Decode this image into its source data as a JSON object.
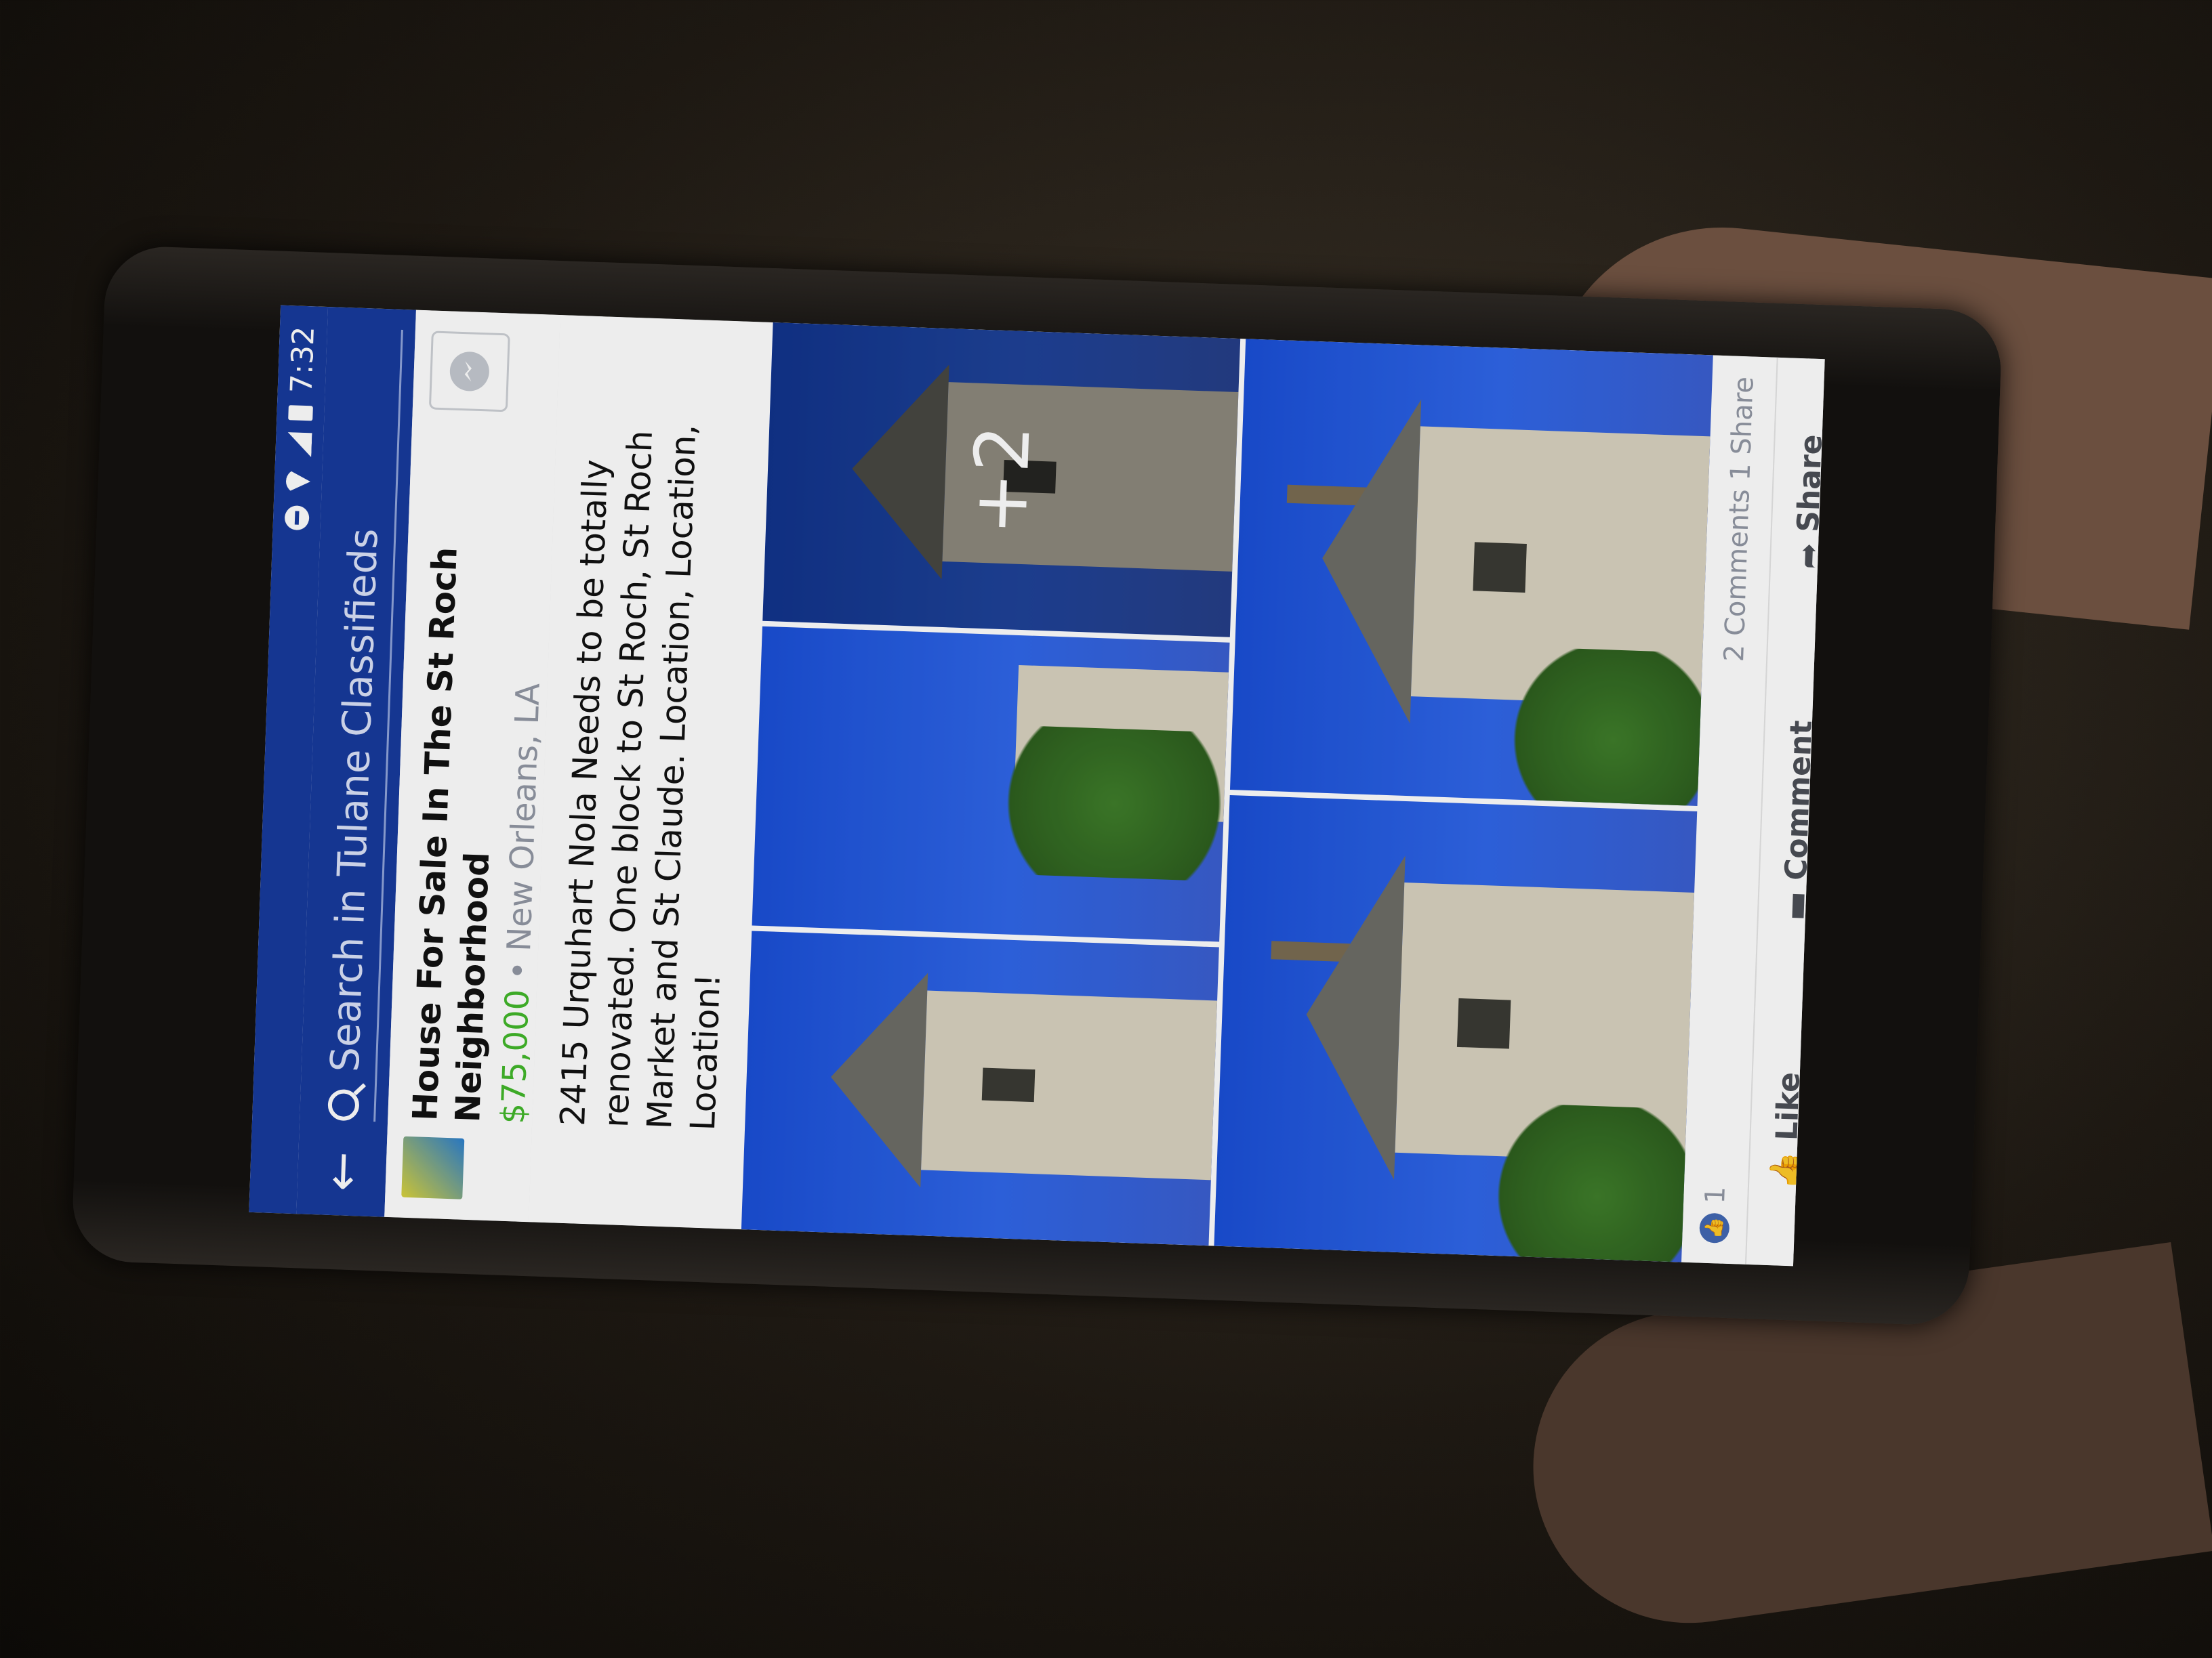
{
  "status_bar": {
    "time": "7:32"
  },
  "search": {
    "placeholder": "Search in Tulane Classifieds"
  },
  "post": {
    "title": "House For Sale In The St Roch Neighborhood",
    "price": "$75,000",
    "separator": "•",
    "location": "New Orleans, LA",
    "description": "2415 Urquhart Nola Needs to be totally renovated. One block to St Roch, St Roch Market and St Claude. Location, Location, Location!",
    "more_photos": "+2"
  },
  "stats": {
    "likes": "1",
    "comments_shares": "2 Comments 1 Share"
  },
  "actions": {
    "like": "Like",
    "comment": "Comment",
    "share": "Share"
  },
  "colors": {
    "header_blue": "#173a9c",
    "price_green": "#42b72a",
    "like_blue": "#4267b2"
  },
  "icons": [
    "back-arrow-icon",
    "search-icon",
    "messenger-icon",
    "like-icon",
    "comment-icon",
    "share-icon"
  ]
}
